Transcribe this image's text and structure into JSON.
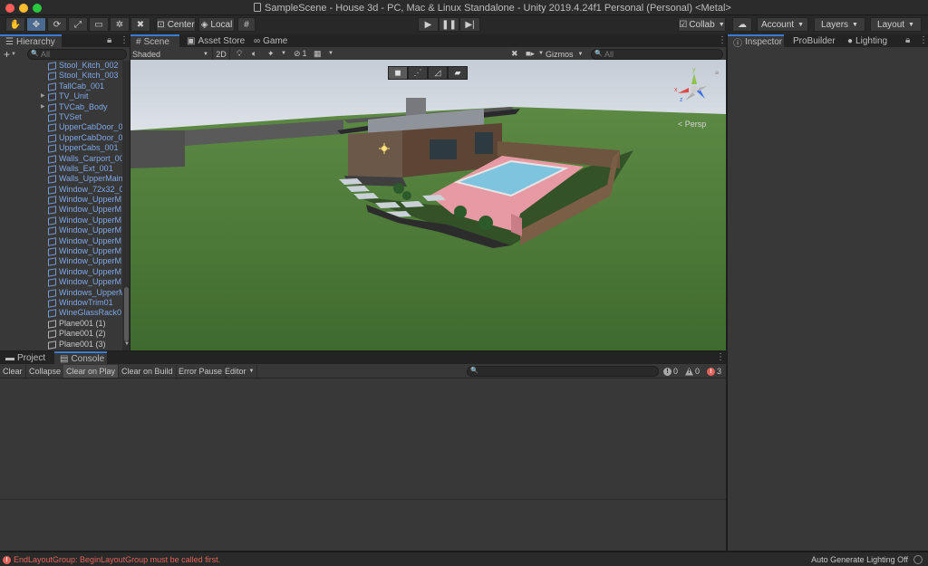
{
  "window": {
    "title": "SampleScene - House 3d - PC, Mac & Linux Standalone - Unity 2019.4.24f1 Personal (Personal) <Metal>"
  },
  "toolbar": {
    "pivot_center": "Center",
    "pivot_local": "Local",
    "collab": "Collab",
    "account": "Account",
    "layers": "Layers",
    "layout": "Layout"
  },
  "hierarchy": {
    "tab": "Hierarchy",
    "search_placeholder": "All",
    "items": [
      {
        "label": "Stool_Kitch_002",
        "prefab": true,
        "fold": false
      },
      {
        "label": "Stool_Kitch_003",
        "prefab": true,
        "fold": false
      },
      {
        "label": "TallCab_001",
        "prefab": true,
        "fold": false
      },
      {
        "label": "TV_Unit",
        "prefab": true,
        "fold": true
      },
      {
        "label": "TVCab_Body",
        "prefab": true,
        "fold": true
      },
      {
        "label": "TVSet",
        "prefab": true,
        "fold": false
      },
      {
        "label": "UpperCabDoor_0",
        "prefab": true,
        "fold": false
      },
      {
        "label": "UpperCabDoor_0",
        "prefab": true,
        "fold": false
      },
      {
        "label": "UpperCabs_001",
        "prefab": true,
        "fold": false
      },
      {
        "label": "Walls_Carport_00",
        "prefab": true,
        "fold": false
      },
      {
        "label": "Walls_Ext_001",
        "prefab": true,
        "fold": false
      },
      {
        "label": "Walls_UpperMain",
        "prefab": true,
        "fold": false
      },
      {
        "label": "Window_72x32_0",
        "prefab": true,
        "fold": false
      },
      {
        "label": "Window_UpperM",
        "prefab": true,
        "fold": false
      },
      {
        "label": "Window_UpperM",
        "prefab": true,
        "fold": false
      },
      {
        "label": "Window_UpperM",
        "prefab": true,
        "fold": false
      },
      {
        "label": "Window_UpperM",
        "prefab": true,
        "fold": false
      },
      {
        "label": "Window_UpperM",
        "prefab": true,
        "fold": false
      },
      {
        "label": "Window_UpperM",
        "prefab": true,
        "fold": false
      },
      {
        "label": "Window_UpperM",
        "prefab": true,
        "fold": false
      },
      {
        "label": "Window_UpperM",
        "prefab": true,
        "fold": false
      },
      {
        "label": "Window_UpperM",
        "prefab": true,
        "fold": false
      },
      {
        "label": "Windows_UpperM",
        "prefab": true,
        "fold": false
      },
      {
        "label": "WindowTrim01",
        "prefab": true,
        "fold": false
      },
      {
        "label": "WineGlassRack0",
        "prefab": true,
        "fold": false
      },
      {
        "label": "Plane001 (1)",
        "prefab": false,
        "fold": false
      },
      {
        "label": "Plane001 (2)",
        "prefab": false,
        "fold": false
      },
      {
        "label": "Plane001 (3)",
        "prefab": false,
        "fold": false
      }
    ]
  },
  "scene_tabs": {
    "scene": "Scene",
    "asset_store": "Asset Store",
    "game": "Game"
  },
  "scene_toolbar": {
    "shading": "Shaded",
    "mode_2d": "2D",
    "hidden_count": "1",
    "gizmos": "Gizmos",
    "search_placeholder": "All",
    "camera_label": "< Persp"
  },
  "bottom_tabs": {
    "project": "Project",
    "console": "Console"
  },
  "console": {
    "clear": "Clear",
    "collapse": "Collapse",
    "clear_on_play": "Clear on Play",
    "clear_on_build": "Clear on Build",
    "error_pause": "Error Pause",
    "editor": "Editor",
    "info_count": "0",
    "warning_count": "0",
    "error_count": "3"
  },
  "right_tabs": {
    "inspector": "Inspector",
    "probuilder": "ProBuilder",
    "lighting": "Lighting"
  },
  "status": {
    "error_message": "EndLayoutGroup: BeginLayoutGroup must be called first.",
    "right_text": "Auto Generate Lighting Off"
  },
  "colors": {
    "accent": "#3a7bd5",
    "error": "#e2645a",
    "sky": "#cfd7df",
    "grass": "#4e7a3a",
    "pool": "#7ec4de",
    "deck": "#e79aa3"
  },
  "icons": [
    "hand-icon",
    "move-icon",
    "rotate-icon",
    "scale-icon",
    "rect-icon",
    "transform-icon",
    "custom-tool-icon",
    "play-icon",
    "pause-icon",
    "step-icon",
    "cloud-icon",
    "lock-icon",
    "kebab-icon",
    "light-icon",
    "audio-icon",
    "effects-icon",
    "visibility-icon",
    "grid-icon",
    "search-icon",
    "camera-icon"
  ]
}
